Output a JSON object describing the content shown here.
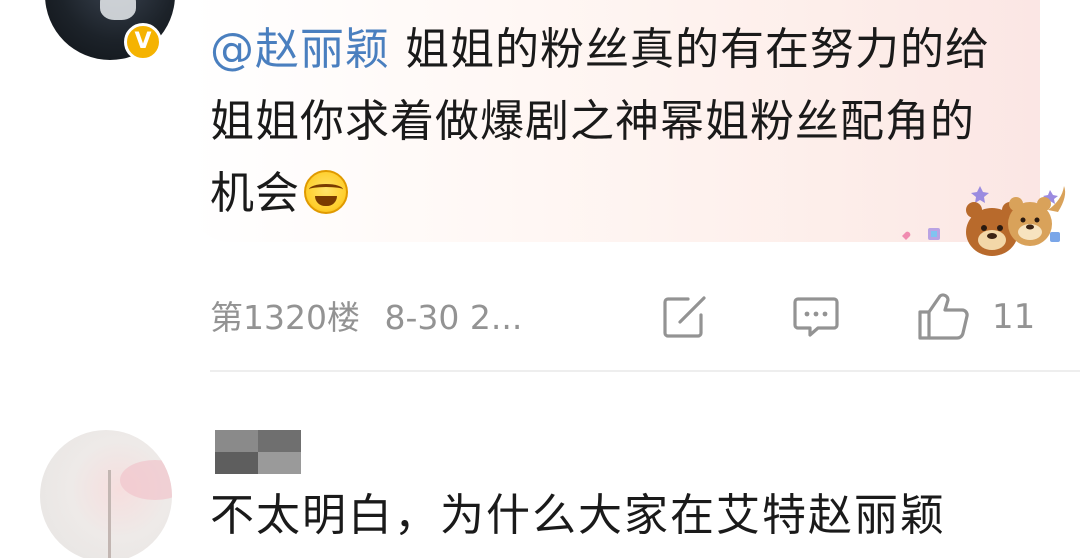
{
  "comment_1": {
    "mention": "@赵丽颖",
    "text": " 姐姐的粉丝真的有在努力的给姐姐你求着做爆剧之神幂姐粉丝配角的机会",
    "emoji": "laugh-cry-emoji",
    "floor": "第1320楼",
    "time": "8-30 2...",
    "like_count": "11",
    "verified_badge": "V",
    "actions": [
      "edit-icon",
      "comment-icon",
      "thumbs-up-icon"
    ]
  },
  "comment_2": {
    "text": "不太明白，为什么大家在艾特赵丽颖"
  },
  "colors": {
    "mention": "#4a7fbf",
    "meta": "#939393",
    "badge": "#f5b301",
    "bubble": "#fdeeea"
  }
}
